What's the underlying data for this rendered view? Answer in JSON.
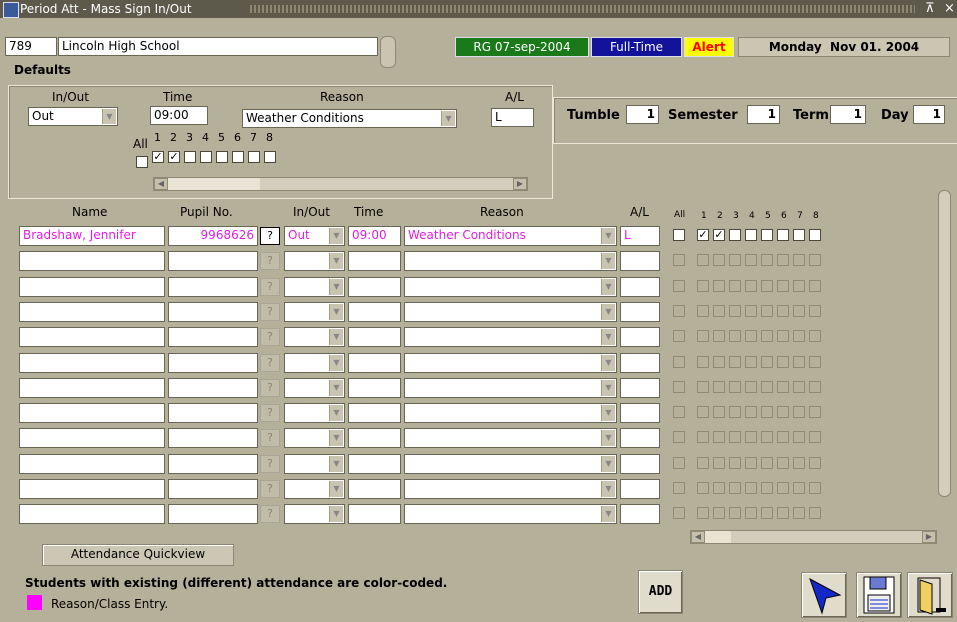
{
  "window": {
    "title": "Period Att - Mass Sign In/Out",
    "restore_glyph": "⊼",
    "close_glyph": "×"
  },
  "header": {
    "school_code": "789",
    "school_name": "Lincoln High School",
    "rg_badge": "RG 07-sep-2004",
    "fulltime_badge": "Full-Time",
    "alert_badge": "Alert",
    "date_label": "Monday  Nov 01. 2004"
  },
  "defaults": {
    "section_label": "Defaults",
    "inout_label": "In/Out",
    "inout_value": "Out",
    "time_label": "Time",
    "time_value": "09:00",
    "reason_label": "Reason",
    "reason_value": "Weather Conditions",
    "al_label": "A/L",
    "al_value": "L",
    "all_label": "All",
    "periods": [
      "1",
      "2",
      "3",
      "4",
      "5",
      "6",
      "7",
      "8"
    ],
    "checked": [
      true,
      true,
      false,
      false,
      false,
      false,
      false,
      false
    ]
  },
  "cycle": {
    "tumble_label": "Tumble",
    "tumble_value": "1",
    "semester_label": "Semester",
    "semester_value": "1",
    "term_label": "Term",
    "term_value": "1",
    "day_label": "Day",
    "day_value": "1"
  },
  "table": {
    "headers": {
      "name": "Name",
      "pupil": "Pupil No.",
      "inout": "In/Out",
      "time": "Time",
      "reason": "Reason",
      "al": "A/L",
      "all": "All"
    },
    "period_headers": [
      "1",
      "2",
      "3",
      "4",
      "5",
      "6",
      "7",
      "8"
    ],
    "help_glyph": "?",
    "rows": [
      {
        "name": "Bradshaw, Jennifer",
        "pupil": "9968626",
        "inout": "Out",
        "time": "09:00",
        "reason": "Weather Conditions",
        "al": "L",
        "checked": [
          true,
          true,
          false,
          false,
          false,
          false,
          false,
          false
        ],
        "active": true
      }
    ]
  },
  "footer": {
    "quickview_button": "Attendance Quickview",
    "note": "Students with existing (different) attendance are color-coded.",
    "legend_label": "Reason/Class Entry.",
    "legend_color": "#ff00ff",
    "add_button": "ADD"
  },
  "colors": {
    "bg": "#b5b09a",
    "rg": "#1a7a1a",
    "fulltime": "#12129a",
    "alert": "#ff0000",
    "alert_bg": "#ffff00",
    "magenta": "#e020e0"
  }
}
